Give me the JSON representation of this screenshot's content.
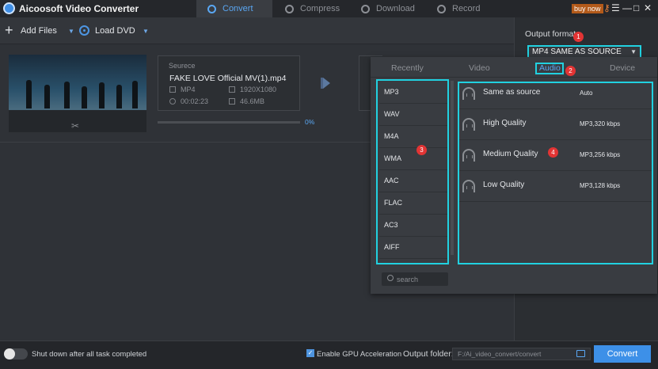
{
  "app": {
    "title": "Aicoosoft Video Converter",
    "buy_now": "buy now"
  },
  "nav": [
    {
      "label": "Convert",
      "icon": "convert-icon",
      "active": true
    },
    {
      "label": "Compress",
      "icon": "compress-icon"
    },
    {
      "label": "Download",
      "icon": "download-icon"
    },
    {
      "label": "Record",
      "icon": "record-icon"
    }
  ],
  "window_controls": {
    "key": "⚷",
    "menu": "☰",
    "minimize": "—",
    "maximize": "□",
    "close": "✕"
  },
  "toolbar": {
    "add_files": "Add Files",
    "load_dvd": "Load DVD"
  },
  "file": {
    "source_label": "Seurece",
    "name": "FAKE LOVE Official MV(1).mp4",
    "format": "MP4",
    "resolution": "1920X1080",
    "duration": "00:02:23",
    "size": "46.6MB",
    "progress_text": "0%",
    "progress": 0
  },
  "output_format": {
    "label": "Output format",
    "value": "MP4 SAME AS SOURCE"
  },
  "dropdown": {
    "tabs": [
      "Recently",
      "Video",
      "Audio",
      "Device"
    ],
    "active_tab": "Audio",
    "formats": [
      "MP3",
      "WAV",
      "M4A",
      "WMA",
      "AAC",
      "FLAC",
      "AC3",
      "AIFF"
    ],
    "qualities": [
      {
        "name": "Same as source",
        "rate": "Auto"
      },
      {
        "name": "High Quality",
        "rate": "MP3,320 kbps"
      },
      {
        "name": "Medium Quality",
        "rate": "MP3,256 kbps"
      },
      {
        "name": "Low Quality",
        "rate": "MP3,128 kbps"
      }
    ],
    "search_placeholder": "search"
  },
  "callouts": [
    "1",
    "2",
    "3",
    "4"
  ],
  "bottom": {
    "shutdown_label": "Shut down after all task completed",
    "gpu_label": "Enable GPU Acceleration",
    "output_folder_label": "Output folder:",
    "output_folder_value": "F:/Ai_video_convert/convert",
    "convert_button": "Convert"
  },
  "colors": {
    "accent": "#3d90e8",
    "highlight": "#21d1e0",
    "callout": "#e23434"
  }
}
